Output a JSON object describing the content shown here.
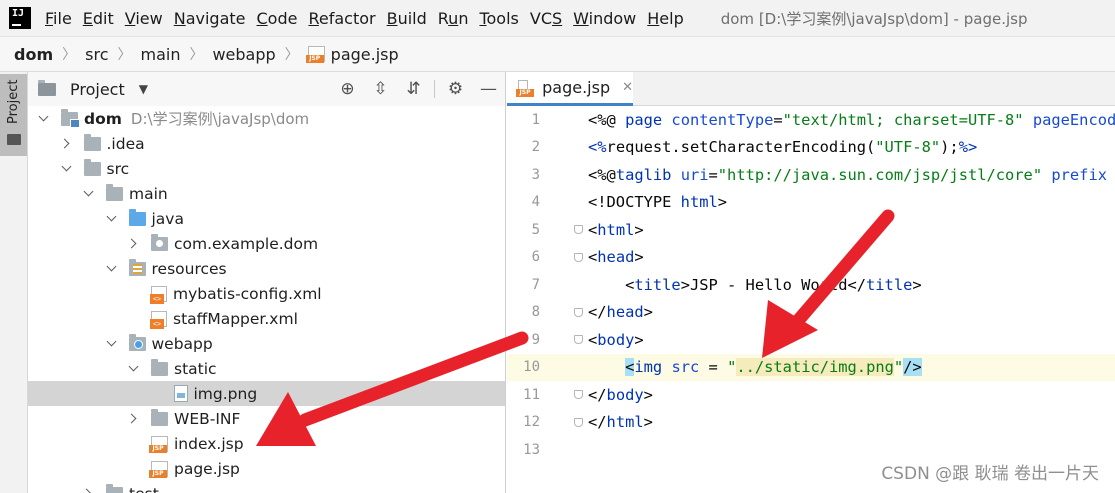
{
  "menubar": {
    "items": [
      {
        "label": "File",
        "mnemonic": "F"
      },
      {
        "label": "Edit",
        "mnemonic": "E"
      },
      {
        "label": "View",
        "mnemonic": "V"
      },
      {
        "label": "Navigate",
        "mnemonic": "N"
      },
      {
        "label": "Code",
        "mnemonic": "C"
      },
      {
        "label": "Refactor",
        "mnemonic": "R"
      },
      {
        "label": "Build",
        "mnemonic": "B"
      },
      {
        "label": "Run",
        "mnemonic": "u"
      },
      {
        "label": "Tools",
        "mnemonic": "T"
      },
      {
        "label": "VCS",
        "mnemonic": "S"
      },
      {
        "label": "Window",
        "mnemonic": "W"
      },
      {
        "label": "Help",
        "mnemonic": "H"
      }
    ],
    "window_title": "dom [D:\\学习案例\\javaJsp\\dom] - page.jsp"
  },
  "breadcrumb": [
    "dom",
    "src",
    "main",
    "webapp",
    "page.jsp"
  ],
  "side_stripe": {
    "label": "Project"
  },
  "project_panel": {
    "title": "Project",
    "tools": [
      "target-icon",
      "expand-all-icon",
      "collapse-all-icon",
      "gear-icon",
      "minimize-icon"
    ],
    "tree": [
      {
        "label": "dom",
        "path": "D:\\学习案例\\javaJsp\\dom",
        "depth": 0,
        "expanded": "down",
        "icon": "module",
        "bold": true
      },
      {
        "label": ".idea",
        "depth": 1,
        "expanded": "right",
        "icon": "folder"
      },
      {
        "label": "src",
        "depth": 1,
        "expanded": "down",
        "icon": "folder"
      },
      {
        "label": "main",
        "depth": 2,
        "expanded": "down",
        "icon": "folder"
      },
      {
        "label": "java",
        "depth": 3,
        "expanded": "down",
        "icon": "folder-blue"
      },
      {
        "label": "com.example.dom",
        "depth": 4,
        "expanded": "right",
        "icon": "package"
      },
      {
        "label": "resources",
        "depth": 3,
        "expanded": "down",
        "icon": "resources"
      },
      {
        "label": "mybatis-config.xml",
        "depth": 4,
        "expanded": "none",
        "icon": "xml"
      },
      {
        "label": "staffMapper.xml",
        "depth": 4,
        "expanded": "none",
        "icon": "xml"
      },
      {
        "label": "webapp",
        "depth": 3,
        "expanded": "down",
        "icon": "web"
      },
      {
        "label": "static",
        "depth": 4,
        "expanded": "down",
        "icon": "folder"
      },
      {
        "label": "img.png",
        "depth": 5,
        "expanded": "none",
        "icon": "png",
        "selected": true
      },
      {
        "label": "WEB-INF",
        "depth": 4,
        "expanded": "right",
        "icon": "folder"
      },
      {
        "label": "index.jsp",
        "depth": 4,
        "expanded": "none",
        "icon": "jsp"
      },
      {
        "label": "page.jsp",
        "depth": 4,
        "expanded": "none",
        "icon": "jsp"
      },
      {
        "label": "test",
        "depth": 2,
        "expanded": "right",
        "icon": "folder"
      }
    ]
  },
  "editor": {
    "tab": {
      "label": "page.jsp"
    },
    "current_line": 10,
    "lines": [
      {
        "n": "1",
        "fold": false,
        "tokens": [
          [
            "d",
            "<%@ "
          ],
          [
            "t",
            "page "
          ],
          [
            "a",
            "contentType"
          ],
          [
            "d",
            "="
          ],
          [
            "s",
            "\"text/html; charset=UTF-8\""
          ],
          [
            "d",
            " "
          ],
          [
            "a",
            "pageEncoding"
          ]
        ]
      },
      {
        "n": "2",
        "fold": false,
        "tokens": [
          [
            "t",
            "<%"
          ],
          [
            "d",
            "request.setCharacterEncoding("
          ],
          [
            "s",
            "\"UTF-8\""
          ],
          [
            "d",
            ");"
          ],
          [
            "t",
            "%>"
          ]
        ]
      },
      {
        "n": "3",
        "fold": false,
        "tokens": [
          [
            "d",
            "<%@"
          ],
          [
            "t",
            "taglib "
          ],
          [
            "a",
            "uri"
          ],
          [
            "d",
            "="
          ],
          [
            "s",
            "\"http://java.sun.com/jsp/jstl/core\""
          ],
          [
            "d",
            " "
          ],
          [
            "a",
            "prefix"
          ]
        ]
      },
      {
        "n": "4",
        "fold": false,
        "tokens": [
          [
            "d",
            "<!DOCTYPE "
          ],
          [
            "k",
            "html"
          ],
          [
            "d",
            ">"
          ]
        ]
      },
      {
        "n": "5",
        "fold": true,
        "tokens": [
          [
            "d",
            "<"
          ],
          [
            "t",
            "html"
          ],
          [
            "d",
            ">"
          ]
        ]
      },
      {
        "n": "6",
        "fold": true,
        "tokens": [
          [
            "d",
            "<"
          ],
          [
            "t",
            "head"
          ],
          [
            "d",
            ">"
          ]
        ]
      },
      {
        "n": "7",
        "fold": false,
        "tokens": [
          [
            "d",
            "    <"
          ],
          [
            "t",
            "title"
          ],
          [
            "d",
            ">JSP - Hello World</"
          ],
          [
            "t",
            "title"
          ],
          [
            "d",
            ">"
          ]
        ]
      },
      {
        "n": "8",
        "fold": true,
        "tokens": [
          [
            "d",
            "</"
          ],
          [
            "t",
            "head"
          ],
          [
            "d",
            ">"
          ]
        ]
      },
      {
        "n": "9",
        "fold": true,
        "tokens": [
          [
            "d",
            "<"
          ],
          [
            "t",
            "body"
          ],
          [
            "d",
            ">"
          ]
        ]
      },
      {
        "n": "10",
        "fold": false,
        "tokens": [
          [
            "d",
            "    "
          ],
          [
            "hltag",
            "<"
          ],
          [
            "t",
            "img "
          ],
          [
            "a",
            "src"
          ],
          [
            "d",
            " = "
          ],
          [
            "s",
            "\""
          ],
          [
            "hlword",
            "../static/img.png"
          ],
          [
            "s",
            "\""
          ],
          [
            "hltag",
            "/>"
          ]
        ]
      },
      {
        "n": "11",
        "fold": true,
        "tokens": [
          [
            "d",
            "</"
          ],
          [
            "t",
            "body"
          ],
          [
            "d",
            ">"
          ]
        ]
      },
      {
        "n": "12",
        "fold": true,
        "tokens": [
          [
            "d",
            "</"
          ],
          [
            "t",
            "html"
          ],
          [
            "d",
            ">"
          ]
        ]
      },
      {
        "n": "13",
        "fold": false,
        "tokens": []
      }
    ]
  },
  "watermark": "CSDN @跟 耿瑞 卷出一片天",
  "colors": {
    "arrow": "#e8222a",
    "tab_underline": "#4083c9",
    "selection": "#d4d4d4",
    "current_line": "#fdfbe3"
  }
}
